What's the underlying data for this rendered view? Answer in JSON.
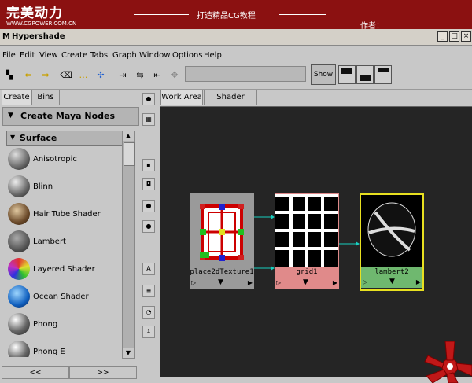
{
  "banner": {
    "logo": "完美动力",
    "url": "WWW.CGPOWER.COM.CN",
    "slogan": "打造精品CG教程",
    "author": "作者："
  },
  "window": {
    "title": "Hypershade"
  },
  "menu": [
    "File",
    "Edit",
    "View",
    "Create",
    "Tabs",
    "Graph",
    "Window",
    "Options",
    "Help"
  ],
  "toolbar": {
    "show_label": "Show",
    "field_value": ""
  },
  "left_tabs": [
    "Create",
    "Bins"
  ],
  "create_header": "Create Maya Nodes",
  "surface_header": "Surface",
  "nodes": [
    "Anisotropic",
    "Blinn",
    "Hair Tube Shader",
    "Lambert",
    "Layered Shader",
    "Ocean Shader",
    "Phong",
    "Phong E"
  ],
  "bottom_arrows": [
    "<<",
    ">>"
  ],
  "work_tabs": [
    "Work Area",
    "Shader Library"
  ],
  "graph_nodes": [
    {
      "label": "place2dTexture1"
    },
    {
      "label": "grid1"
    },
    {
      "label": "lambert2"
    }
  ],
  "colors": {
    "banner": "#8b1111",
    "lambert_outline": "#e8e020",
    "lambert_label": "#6fb86f",
    "grid_label": "#e08a8a",
    "place_label": "#9a9a9a",
    "connector": "#18d0c0"
  }
}
